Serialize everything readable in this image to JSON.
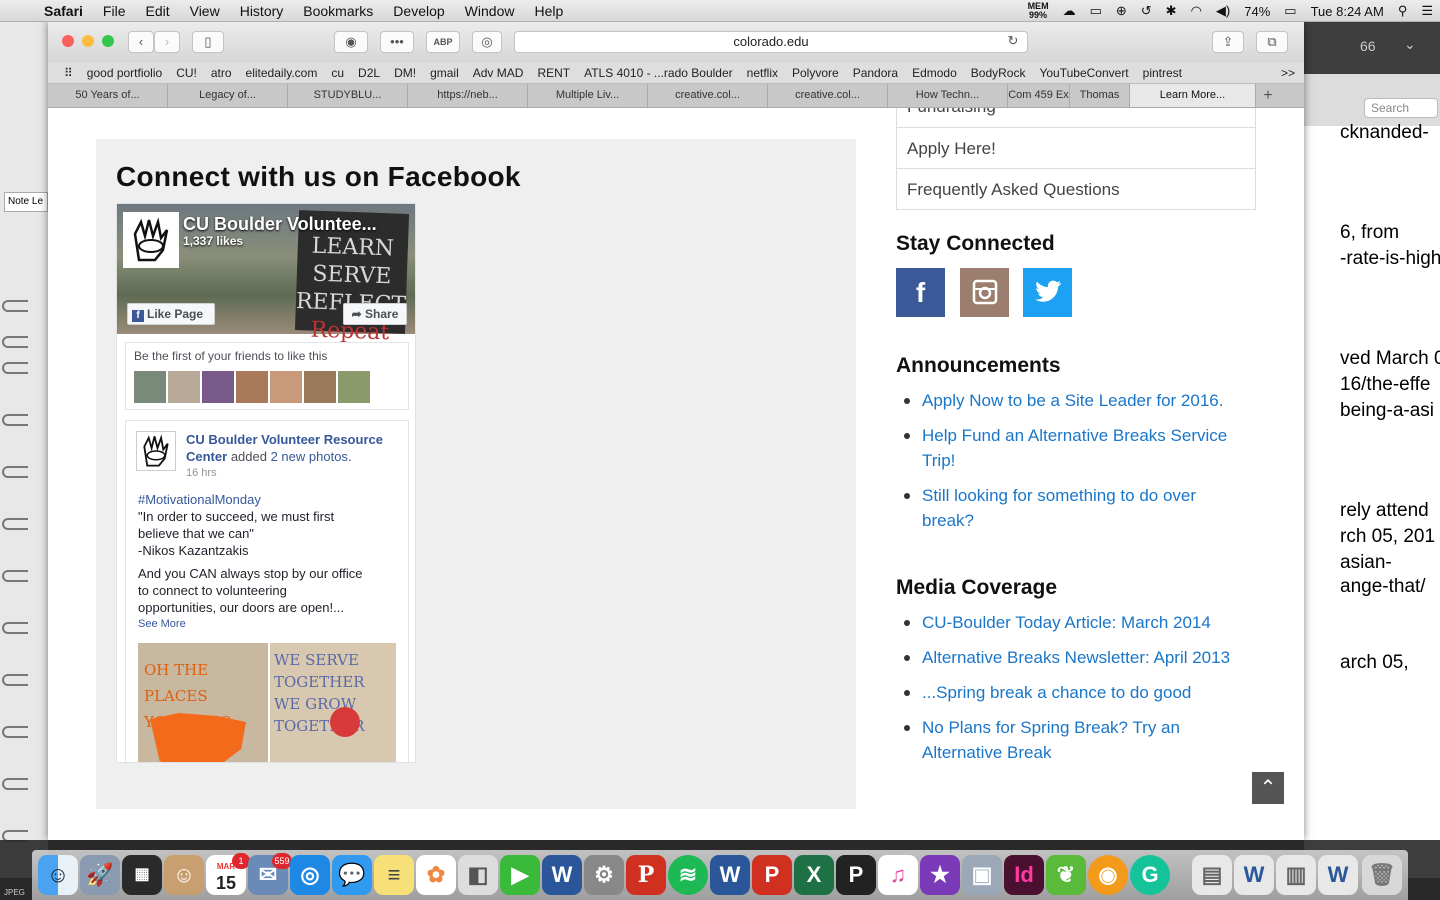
{
  "menubar": {
    "app": "Safari",
    "items": [
      "File",
      "Edit",
      "View",
      "History",
      "Bookmarks",
      "Develop",
      "Window",
      "Help"
    ],
    "mem_label": "MEM",
    "mem_value": "99%",
    "battery": "74%",
    "clock": "Tue 8:24 AM"
  },
  "browser": {
    "url": "colorado.edu",
    "favorites": [
      "good portfiolio",
      "CU!",
      "atro",
      "elitedaily.com",
      "cu",
      "D2L",
      "DM!",
      "gmail",
      "Adv MAD",
      "RENT",
      "ATLS 4010 - ...rado Boulder",
      "netflix",
      "Polyvore",
      "Pandora",
      "Edmodo",
      "BodyRock",
      "YouTubeConvert",
      "pintrest"
    ],
    "favorites_more": ">>",
    "tabs": [
      "50 Years of...",
      "Legacy of...",
      "STUDYBLU...",
      "https://neb...",
      "Multiple Liv...",
      "creative.col...",
      "creative.col...",
      "How Techn...",
      "Com 459 Ex",
      "Thomas",
      "Learn More..."
    ],
    "new_tab": "+"
  },
  "facebook_section": {
    "heading": "Connect with us on Facebook",
    "page_name": "CU Boulder Voluntee...",
    "likes": "1,337 likes",
    "like_button": "Like Page",
    "share_button": "Share",
    "cover_sign": [
      "LEARN",
      "SERVE",
      "REFLECT",
      "Repeat"
    ],
    "friends_text": "Be the first of your friends to like this",
    "post": {
      "author": "CU Boulder Volunteer Resource Center",
      "action": "added",
      "action_link": "2 new photos",
      "time": "16 hrs",
      "hashtag": "#MotivationalMonday",
      "quote_line1": "\"In order to succeed, we must first",
      "quote_line2": "believe that we can\"",
      "quote_author": "-Nikos Kazantzakis",
      "body_line1": "And you CAN always stop by our office",
      "body_line2": "to connect to volunteering",
      "body_line3": "opportunities, our doors are open!...",
      "see_more": "See More",
      "photo1_text": "OH THE PLACES YOU'LL GO",
      "photo2_text": "WE SERVE TOGETHER WE GROW TOGETHER"
    }
  },
  "sidebar": {
    "nav_partial": "Fundraising",
    "nav_items": [
      "Apply Here!",
      "Frequently Asked Questions"
    ],
    "stay_connected": "Stay Connected",
    "social": [
      {
        "name": "facebook",
        "glyph": "f",
        "color": "#3b5998"
      },
      {
        "name": "instagram",
        "glyph": "◙",
        "color": "#9b7e6e"
      },
      {
        "name": "twitter",
        "glyph": "t",
        "color": "#1da1f2"
      }
    ],
    "announcements_heading": "Announcements",
    "announcements": [
      "Apply Now to be a Site Leader for 2016.",
      "Help Fund an Alternative Breaks Service Trip!",
      "Still looking for something to do over break?"
    ],
    "media_heading": "Media Coverage",
    "media": [
      "CU-Boulder Today Article: March 2014",
      "Alternative Breaks Newsletter: April 2013",
      "...Spring break a chance to do good",
      "No Plans for Spring Break? Try an Alternative Break"
    ],
    "back_to_top": "⌃"
  },
  "right_window": {
    "search_placeholder": "Search",
    "counter": "66",
    "lines": [
      "cknanded-",
      "6, from",
      "-rate-is-high",
      "ved March 0",
      "16/the-effe",
      "being-a-asi",
      "rely attend",
      "rch 05, 201",
      "asian-",
      "ange-that/",
      "arch 05,"
    ]
  },
  "left_window": {
    "note_label": "Note Le",
    "jpeg_label": "JPEG"
  },
  "dock": {
    "calendar_month": "MAR",
    "calendar_day": "15",
    "calendar_badge": "1",
    "mail_badge": "559"
  }
}
